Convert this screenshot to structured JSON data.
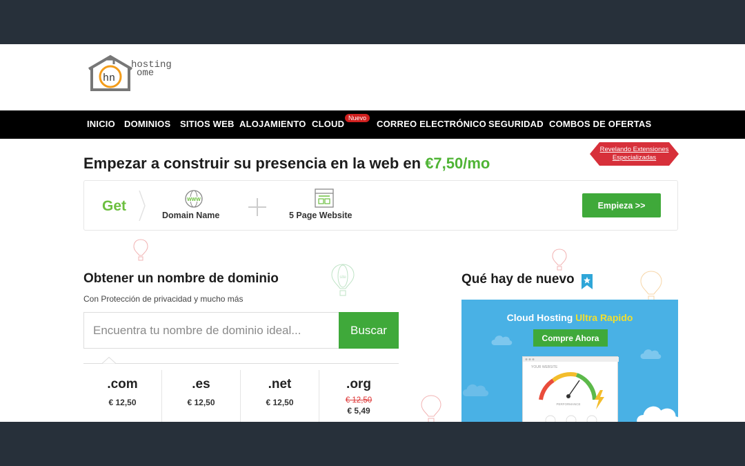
{
  "logo": {
    "line1": "hosting",
    "line2": "ome"
  },
  "nav": {
    "items": [
      "INICIO",
      "DOMINIOS",
      "SITIOS WEB",
      "ALOJAMIENTO",
      "CLOUD",
      "CORREO ELECTRÓNICO",
      "SEGURIDAD",
      "COMBOS DE OFERTAS"
    ],
    "cloud_badge": "Nuevo"
  },
  "promo": {
    "line1": "Revelando Extensiones",
    "line2": "Especializadas"
  },
  "hero": {
    "title_prefix": "Empezar a construir su presencia en la web en ",
    "price": "€7,50/mo"
  },
  "get_box": {
    "get_label": "Get",
    "www_text": "WWW",
    "domain_label": "Domain Name",
    "page_label": "5 Page Website",
    "button": "Empieza >>"
  },
  "balloon_label": "site",
  "domain_section": {
    "title": "Obtener un nombre de dominio",
    "subtitle": "Con Protección de privacidad y mucho más",
    "search_placeholder": "Encuentra tu nombre de dominio ideal...",
    "search_button": "Buscar",
    "tlds": [
      {
        "name": ".com",
        "price": "€ 12,50"
      },
      {
        "name": ".es",
        "price": "€ 12,50"
      },
      {
        "name": ".net",
        "price": "€ 12,50"
      },
      {
        "name": ".org",
        "old_price": "€ 12,50",
        "price": "€ 5,49"
      }
    ]
  },
  "news": {
    "title": "Qué hay de nuevo",
    "banner_prefix": "Cloud Hosting ",
    "banner_highlight": "Ultra Rapido",
    "button": "Compre Ahora",
    "browser_label": "YOUR WEBSITE",
    "gauge_label": "PERFORMANCE"
  },
  "colors": {
    "green": "#3fa93a",
    "price_green": "#4fb435",
    "nav_bg": "#000000",
    "frame": "#27303a",
    "news_blue": "#49b1e5",
    "badge_red": "#d0201f",
    "highlight_yellow": "#f3df2c"
  }
}
